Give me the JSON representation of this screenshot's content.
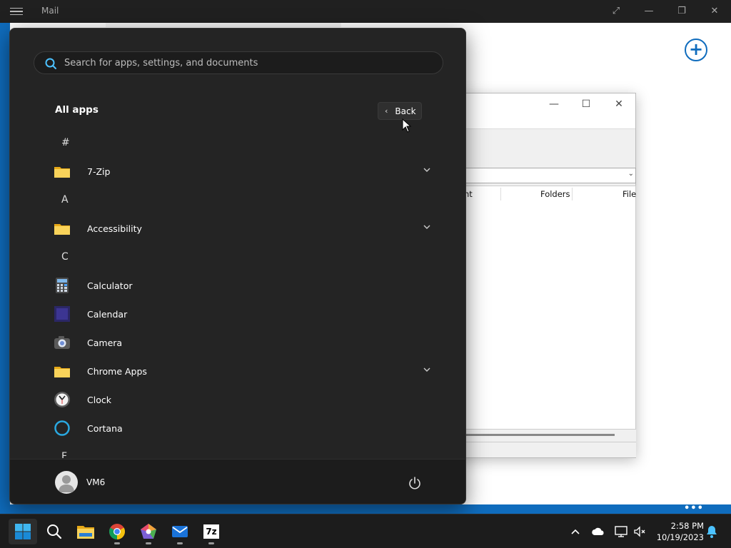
{
  "mail": {
    "title": "Mail",
    "add_symbol": "+",
    "more_symbol": "•••"
  },
  "zip_window": {
    "columns": [
      "nt",
      "Folders",
      "File"
    ]
  },
  "start_menu": {
    "search_placeholder": "Search for apps, settings, and documents",
    "section_title": "All apps",
    "back_label": "Back",
    "list": [
      {
        "kind": "letter",
        "text": "#"
      },
      {
        "kind": "app",
        "name": "7-Zip",
        "icon": "folder-icon",
        "expandable": true
      },
      {
        "kind": "letter",
        "text": "A"
      },
      {
        "kind": "app",
        "name": "Accessibility",
        "icon": "folder-icon",
        "expandable": true
      },
      {
        "kind": "letter",
        "text": "C"
      },
      {
        "kind": "app",
        "name": "Calculator",
        "icon": "calculator-icon",
        "expandable": false
      },
      {
        "kind": "app",
        "name": "Calendar",
        "icon": "calendar-icon",
        "expandable": false
      },
      {
        "kind": "app",
        "name": "Camera",
        "icon": "camera-icon",
        "expandable": false
      },
      {
        "kind": "app",
        "name": "Chrome Apps",
        "icon": "folder-icon",
        "expandable": true
      },
      {
        "kind": "app",
        "name": "Clock",
        "icon": "clock-icon",
        "expandable": false
      },
      {
        "kind": "app",
        "name": "Cortana",
        "icon": "cortana-icon",
        "expandable": false
      },
      {
        "kind": "letter",
        "text": "F"
      }
    ],
    "user_name": "VM6"
  },
  "taskbar": {
    "apps": [
      "start-icon",
      "search-icon",
      "file-explorer-icon",
      "chrome-icon",
      "pentagon-app-icon",
      "mail-icon",
      "7zip-icon"
    ],
    "sevenzip_label": "7z",
    "time": "2:58 PM",
    "date": "10/19/2023"
  },
  "colors": {
    "accent": "#0f6cbd",
    "start_bg": "#242424",
    "taskbar_bg": "#1c1c1c",
    "folder": "#f4c542"
  }
}
